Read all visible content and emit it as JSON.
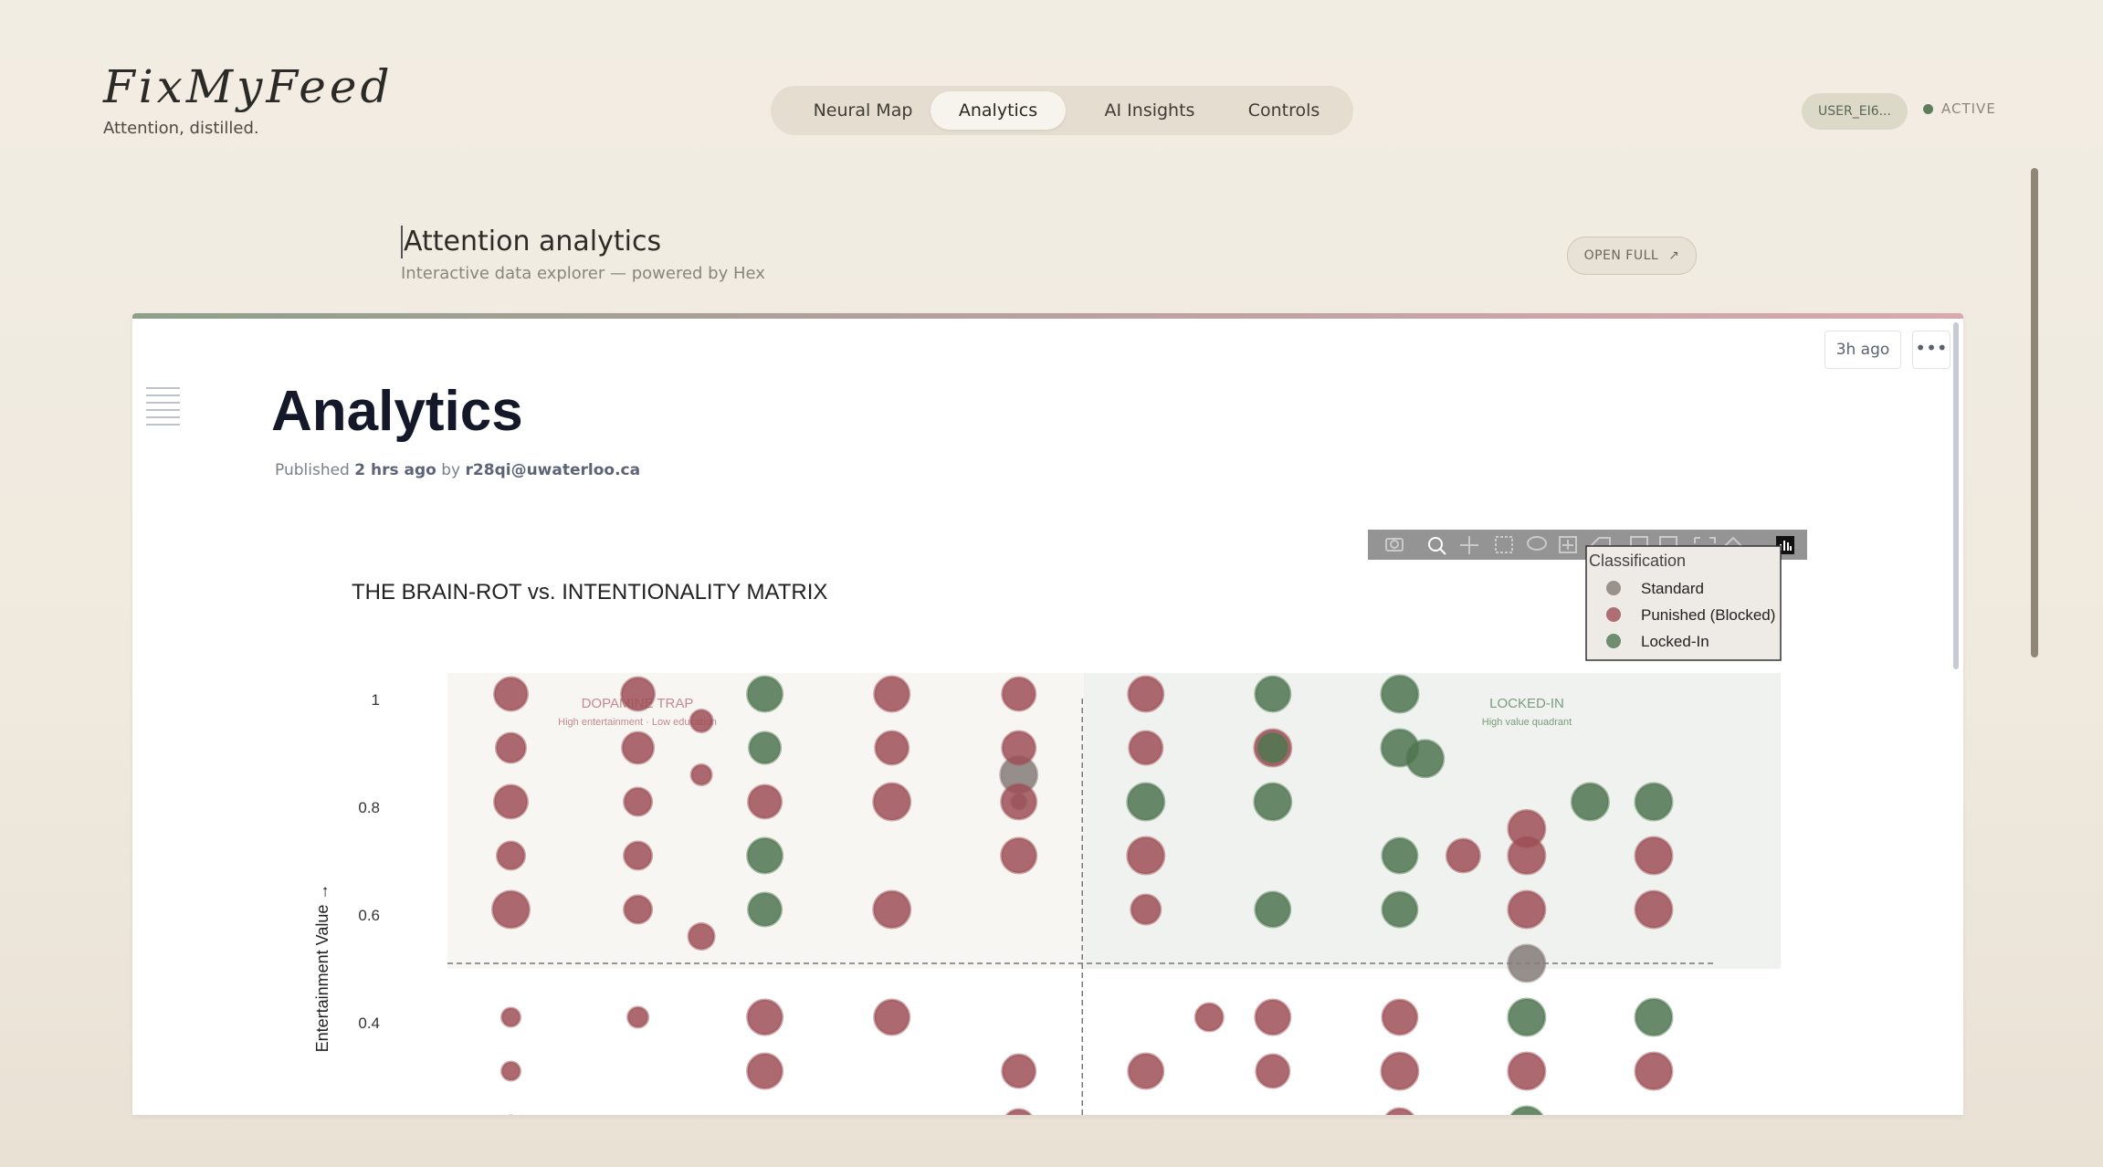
{
  "brand": {
    "logo": "FixMyFeed",
    "tagline": "Attention, distilled."
  },
  "nav": {
    "items": [
      {
        "label": "Neural Map",
        "active": false
      },
      {
        "label": "Analytics",
        "active": true
      },
      {
        "label": "AI Insights",
        "active": false
      },
      {
        "label": "Controls",
        "active": false
      }
    ]
  },
  "user": {
    "id": "USER_EI6...",
    "status": "ACTIVE"
  },
  "section": {
    "title": "Attention analytics",
    "subtitle": "Interactive data explorer — powered by Hex",
    "open_full": "OPEN FULL"
  },
  "notebook": {
    "last_run": "3h ago",
    "title": "Analytics",
    "published_prefix": "Published",
    "published_time": "2 hrs ago",
    "published_by": "by",
    "author": "r28qi@uwaterloo.ca"
  },
  "chart_data": {
    "type": "scatter",
    "title": "THE BRAIN-ROT vs. INTENTIONALITY MATRIX",
    "xlabel": "",
    "ylabel": "Entertainment Value →",
    "yticks": [
      "1",
      "0.8",
      "0.6",
      "0.4"
    ],
    "ylim": [
      0.19,
      1.11
    ],
    "xlim": [
      -0.05,
      1.0
    ],
    "grid": false,
    "legend": {
      "title": "Classification",
      "position": "top-right"
    },
    "colors": {
      "Standard": "#857b77",
      "Punished (Blocked)": "#9e4f56",
      "Locked-In": "#4f7650"
    },
    "annotations": [
      {
        "label": "DOPAMINE TRAP",
        "sub": "High entertainment · Low education",
        "color": "#c48a8e"
      },
      {
        "label": "LOCKED-IN",
        "sub": "High value quadrant",
        "color": "#7c9c7c"
      }
    ],
    "threshold": {
      "x": 0.45,
      "y": 0.5
    },
    "series": [
      {
        "name": "Standard",
        "points": [
          {
            "x": 0.4,
            "y": 0.85,
            "size": 20
          },
          {
            "x": 0.4,
            "y": 0.8,
            "size": 8
          },
          {
            "x": 0.8,
            "y": 0.5,
            "size": 20
          }
        ]
      },
      {
        "name": "Punished (Blocked)",
        "points": [
          {
            "x": 0.0,
            "y": 1.0,
            "size": 18
          },
          {
            "x": 0.0,
            "y": 0.9,
            "size": 16
          },
          {
            "x": 0.0,
            "y": 0.8,
            "size": 18
          },
          {
            "x": 0.0,
            "y": 0.7,
            "size": 15
          },
          {
            "x": 0.0,
            "y": 0.6,
            "size": 20
          },
          {
            "x": 0.0,
            "y": 0.4,
            "size": 10
          },
          {
            "x": 0.0,
            "y": 0.3,
            "size": 10
          },
          {
            "x": 0.0,
            "y": 0.2,
            "size": 10
          },
          {
            "x": 0.1,
            "y": 1.0,
            "size": 18
          },
          {
            "x": 0.1,
            "y": 0.9,
            "size": 17
          },
          {
            "x": 0.1,
            "y": 0.8,
            "size": 15
          },
          {
            "x": 0.1,
            "y": 0.7,
            "size": 15
          },
          {
            "x": 0.1,
            "y": 0.6,
            "size": 15
          },
          {
            "x": 0.1,
            "y": 0.4,
            "size": 11
          },
          {
            "x": 0.15,
            "y": 0.95,
            "size": 12
          },
          {
            "x": 0.15,
            "y": 0.85,
            "size": 11
          },
          {
            "x": 0.15,
            "y": 0.55,
            "size": 14
          },
          {
            "x": 0.2,
            "y": 0.8,
            "size": 18
          },
          {
            "x": 0.2,
            "y": 0.4,
            "size": 19
          },
          {
            "x": 0.2,
            "y": 0.3,
            "size": 19
          },
          {
            "x": 0.3,
            "y": 1.0,
            "size": 19
          },
          {
            "x": 0.3,
            "y": 0.9,
            "size": 18
          },
          {
            "x": 0.3,
            "y": 0.8,
            "size": 20
          },
          {
            "x": 0.3,
            "y": 0.6,
            "size": 20
          },
          {
            "x": 0.3,
            "y": 0.4,
            "size": 19
          },
          {
            "x": 0.4,
            "y": 1.0,
            "size": 18
          },
          {
            "x": 0.4,
            "y": 0.9,
            "size": 18
          },
          {
            "x": 0.4,
            "y": 0.8,
            "size": 19
          },
          {
            "x": 0.4,
            "y": 0.7,
            "size": 19
          },
          {
            "x": 0.4,
            "y": 0.3,
            "size": 18
          },
          {
            "x": 0.4,
            "y": 0.2,
            "size": 17
          },
          {
            "x": 0.5,
            "y": 1.0,
            "size": 19
          },
          {
            "x": 0.5,
            "y": 0.9,
            "size": 18
          },
          {
            "x": 0.5,
            "y": 0.7,
            "size": 20
          },
          {
            "x": 0.5,
            "y": 0.6,
            "size": 16
          },
          {
            "x": 0.5,
            "y": 0.3,
            "size": 19
          },
          {
            "x": 0.55,
            "y": 0.4,
            "size": 15
          },
          {
            "x": 0.6,
            "y": 0.9,
            "size": 20
          },
          {
            "x": 0.6,
            "y": 0.4,
            "size": 19
          },
          {
            "x": 0.6,
            "y": 0.3,
            "size": 18
          },
          {
            "x": 0.7,
            "y": 0.4,
            "size": 19
          },
          {
            "x": 0.7,
            "y": 0.3,
            "size": 20
          },
          {
            "x": 0.7,
            "y": 0.2,
            "size": 18
          },
          {
            "x": 0.75,
            "y": 0.7,
            "size": 18
          },
          {
            "x": 0.8,
            "y": 0.75,
            "size": 20
          },
          {
            "x": 0.8,
            "y": 0.7,
            "size": 20
          },
          {
            "x": 0.8,
            "y": 0.6,
            "size": 20
          },
          {
            "x": 0.8,
            "y": 0.3,
            "size": 20
          },
          {
            "x": 0.9,
            "y": 0.7,
            "size": 20
          },
          {
            "x": 0.9,
            "y": 0.6,
            "size": 20
          },
          {
            "x": 0.9,
            "y": 0.3,
            "size": 20
          }
        ]
      },
      {
        "name": "Locked-In",
        "points": [
          {
            "x": 0.2,
            "y": 1.0,
            "size": 19
          },
          {
            "x": 0.2,
            "y": 0.9,
            "size": 17
          },
          {
            "x": 0.2,
            "y": 0.7,
            "size": 19
          },
          {
            "x": 0.2,
            "y": 0.6,
            "size": 18
          },
          {
            "x": 0.5,
            "y": 0.8,
            "size": 20
          },
          {
            "x": 0.6,
            "y": 1.0,
            "size": 19
          },
          {
            "x": 0.6,
            "y": 0.9,
            "size": 16
          },
          {
            "x": 0.6,
            "y": 0.8,
            "size": 20
          },
          {
            "x": 0.6,
            "y": 0.6,
            "size": 19
          },
          {
            "x": 0.7,
            "y": 1.0,
            "size": 20
          },
          {
            "x": 0.7,
            "y": 0.9,
            "size": 20
          },
          {
            "x": 0.7,
            "y": 0.7,
            "size": 19
          },
          {
            "x": 0.7,
            "y": 0.6,
            "size": 19
          },
          {
            "x": 0.72,
            "y": 0.88,
            "size": 20
          },
          {
            "x": 0.85,
            "y": 0.8,
            "size": 20
          },
          {
            "x": 0.9,
            "y": 0.8,
            "size": 20
          },
          {
            "x": 0.9,
            "y": 0.4,
            "size": 20
          },
          {
            "x": 0.8,
            "y": 0.4,
            "size": 20
          },
          {
            "x": 0.8,
            "y": 0.2,
            "size": 20
          }
        ]
      }
    ]
  },
  "chart_toolbar": {
    "icons": [
      "camera-icon",
      "zoom-icon",
      "pan-icon",
      "box-select-icon",
      "lasso-icon",
      "zoom-in-icon",
      "erase-icon",
      "plus-icon",
      "minus-icon",
      "autoscale-icon",
      "home-icon",
      "logo-icon"
    ]
  }
}
